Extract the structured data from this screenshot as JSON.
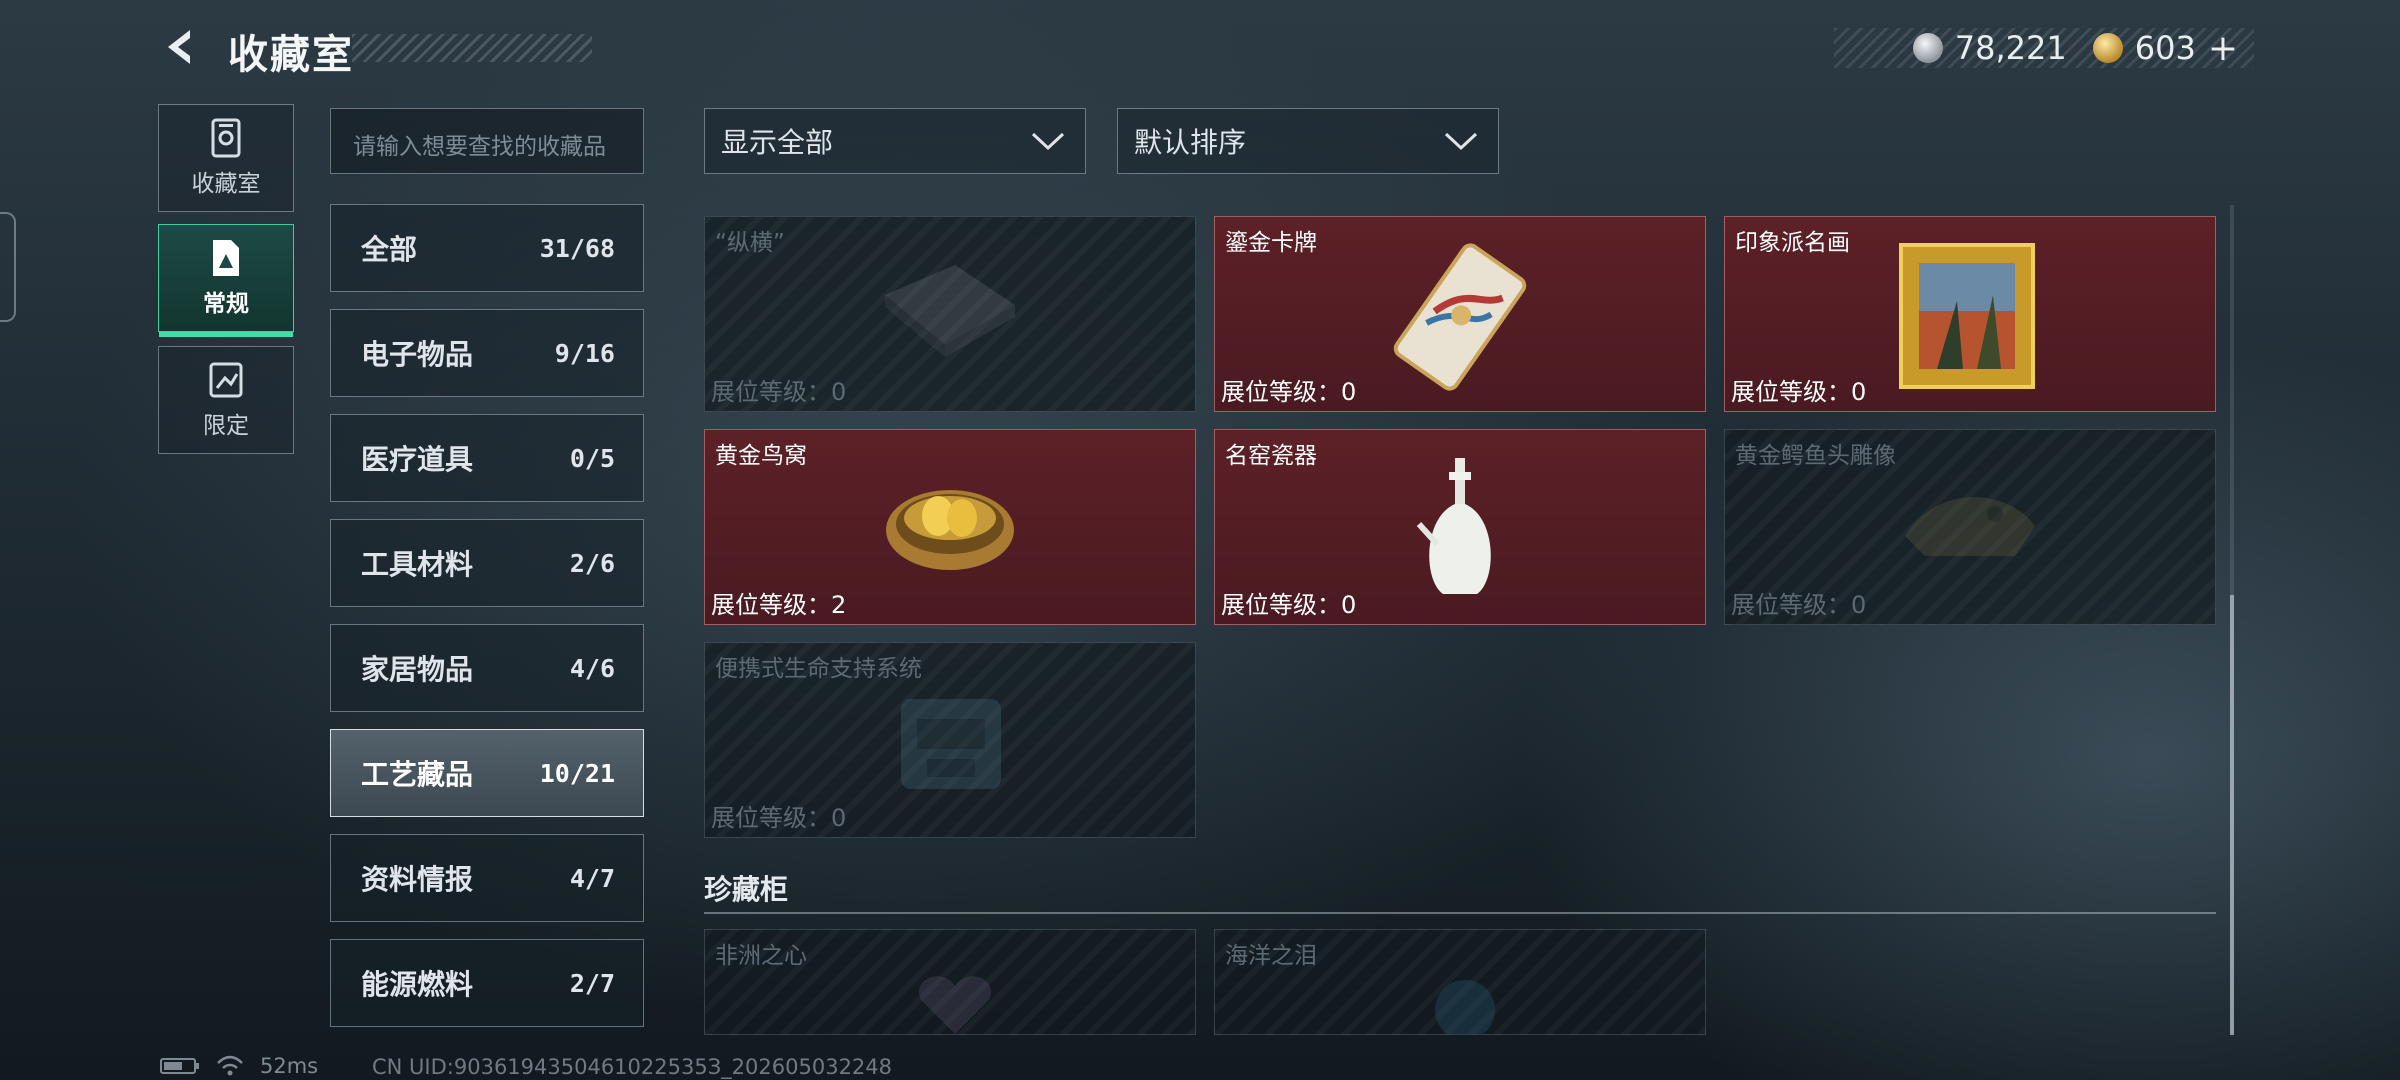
{
  "header": {
    "title": "收藏室"
  },
  "currency": [
    {
      "icon": "silver-coin-icon",
      "value": "78,221"
    },
    {
      "icon": "gold-coin-icon",
      "value": "603",
      "plus": "+"
    }
  ],
  "side_nav": [
    {
      "label": "收藏室",
      "icon": "collection-room-icon",
      "active": false
    },
    {
      "label": "常规",
      "icon": "regular-icon",
      "active": true
    },
    {
      "label": "限定",
      "icon": "limited-icon",
      "active": false
    }
  ],
  "search": {
    "placeholder": "请输入想要查找的收藏品"
  },
  "categories": [
    {
      "name": "全部",
      "count": "31/68"
    },
    {
      "name": "电子物品",
      "count": "9/16"
    },
    {
      "name": "医疗道具",
      "count": "0/5"
    },
    {
      "name": "工具材料",
      "count": "2/6"
    },
    {
      "name": "家居物品",
      "count": "4/6"
    },
    {
      "name": "工艺藏品",
      "count": "10/21",
      "active": true
    },
    {
      "name": "资料情报",
      "count": "4/7"
    },
    {
      "name": "能源燃料",
      "count": "2/7"
    }
  ],
  "filters": {
    "show": "显示全部",
    "sort": "默认排序"
  },
  "items": [
    {
      "name": "“纵横”",
      "level": "展位等级：0",
      "owned": false,
      "icon": "chess-board-icon"
    },
    {
      "name": "鎏金卡牌",
      "level": "展位等级：0",
      "owned": true,
      "icon": "gilded-card-icon"
    },
    {
      "name": "印象派名画",
      "level": "展位等级：0",
      "owned": true,
      "icon": "painting-icon"
    },
    {
      "name": "黄金鸟窝",
      "level": "展位等级：2",
      "owned": true,
      "icon": "golden-nest-icon"
    },
    {
      "name": "名窑瓷器",
      "level": "展位等级：0",
      "owned": true,
      "icon": "porcelain-vase-icon"
    },
    {
      "name": "黄金鳄鱼头雕像",
      "level": "展位等级：0",
      "owned": false,
      "icon": "crocodile-statue-icon"
    },
    {
      "name": "便携式生命支持系统",
      "level": "展位等级：0",
      "owned": false,
      "icon": "life-support-icon"
    }
  ],
  "cabinet": {
    "title": "珍藏柜",
    "items": [
      {
        "name": "非洲之心",
        "owned": false,
        "icon": "heart-gem-icon"
      },
      {
        "name": "海洋之泪",
        "owned": false,
        "icon": "ocean-gem-icon"
      }
    ]
  },
  "footer": {
    "ping": "52ms",
    "uid": "CN UID:9036194350461022535З_202605032248"
  },
  "colors": {
    "accent": "#3fe0a8",
    "owned_card": "#5d2027"
  }
}
